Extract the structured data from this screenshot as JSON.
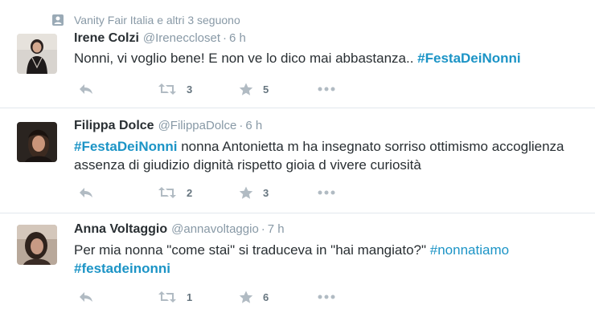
{
  "context": {
    "text": "Vanity Fair Italia e altri 3 seguono",
    "icon": "person-follow-icon"
  },
  "colors": {
    "hashtag": "#1c94c6",
    "muted": "#8899a6",
    "action_icon": "#b1bbc3",
    "divider": "#e1e8ed"
  },
  "tweets": [
    {
      "fullname": "Irene Colzi",
      "username": "@Ireneccloset",
      "separator": "·",
      "time": "6 h",
      "text_plain": "Nonni, vi voglio bene! E non ve lo dico mai abbastanza.. ",
      "text_hashtag": "#FestaDeiNonni",
      "retweets": "3",
      "favorites": "5"
    },
    {
      "fullname": "Filippa Dolce",
      "username": "@FilippaDolce",
      "separator": "·",
      "time": "6 h",
      "text_hashtag": "#FestaDeiNonni",
      "text_plain": " nonna Antonietta m ha insegnato sorriso ottimismo accoglienza assenza di giudizio dignità rispetto  gioia d vivere curiosità",
      "retweets": "2",
      "favorites": "3"
    },
    {
      "fullname": "Anna Voltaggio",
      "username": "@annavoltaggio",
      "separator": "·",
      "time": "7 h",
      "text_plain": "Per mia nonna \"come stai\" si traduceva in \"hai mangiato?\" ",
      "text_hashtag_1": "#nonnatiamo",
      "text_hashtag_2": "#festadeinonni",
      "retweets": "1",
      "favorites": "6"
    }
  ],
  "icons": {
    "reply": "reply-icon",
    "retweet": "retweet-icon",
    "favorite": "star-icon",
    "more": "more-dots-icon"
  }
}
